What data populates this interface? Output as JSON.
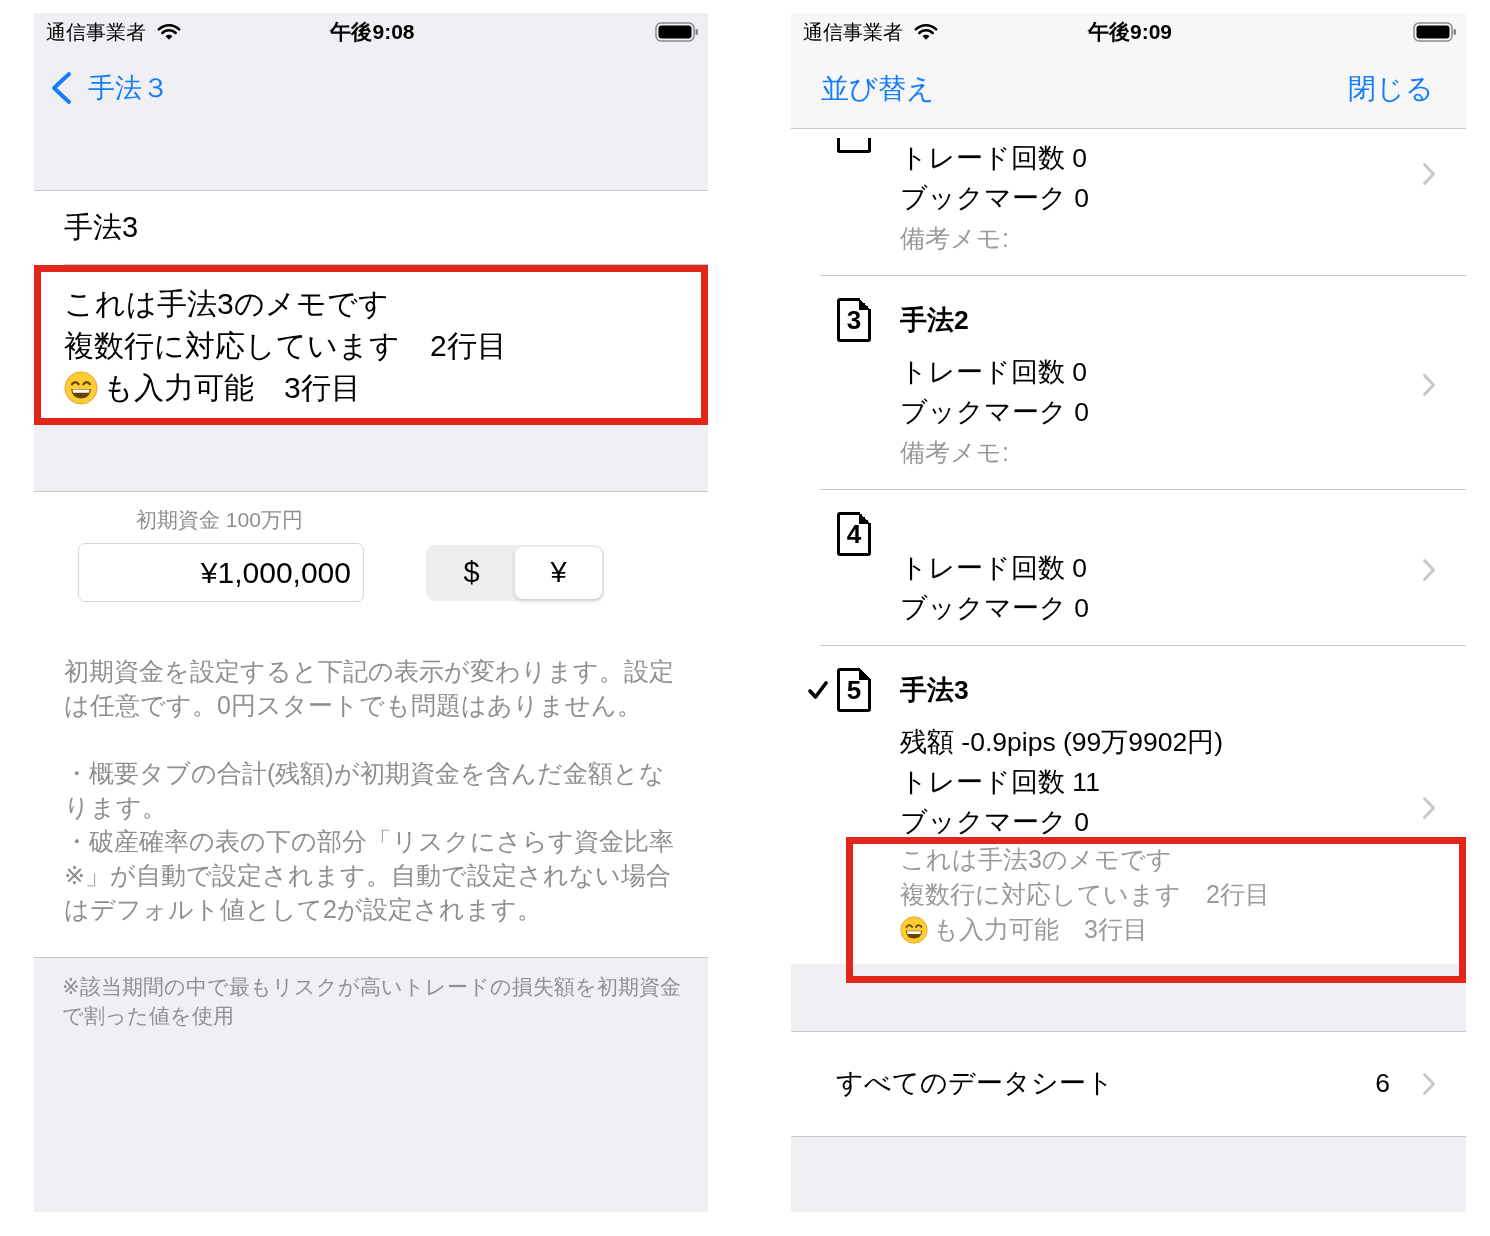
{
  "edit_screen": {
    "status_bar": {
      "carrier": "通信事業者",
      "time": "午後9:08"
    },
    "nav_bar": {
      "back_label": "手法３"
    },
    "name_field": {
      "value": "手法3"
    },
    "memo_field": {
      "highlighted": true,
      "lines": [
        {
          "text": "これは手法3のメモです",
          "leading_emoji": false
        },
        {
          "text": "複数行に対応しています　2行目",
          "leading_emoji": false
        },
        {
          "text": "も入力可能　3行目",
          "leading_emoji": true
        }
      ]
    },
    "initial_capital": {
      "label": "初期資金 100万円",
      "value": "¥1,000,000",
      "currency_segments": [
        {
          "label": "$",
          "selected": false
        },
        {
          "label": "¥",
          "selected": true
        }
      ]
    },
    "help_blocks": [
      [
        "初期資金を設定すると下記の表示が変わります。設定は任意です。0円スタートでも問題はありません。"
      ],
      [
        "・概要タブの合計(残額)が初期資金を含んだ金額となります。",
        "・破産確率の表の下の部分「リスクにさらす資金比率※」が自動で設定されます。自動で設定されない場合はデフォルト値として2が設定されます。"
      ]
    ],
    "footnote": "※該当期間の中で最もリスクが高いトレードの損失額を初期資金で割った値を使用"
  },
  "list_screen": {
    "status_bar": {
      "carrier": "通信事業者",
      "time": "午後9:09"
    },
    "nav_bar": {
      "left_button": "並び替え",
      "right_button": "閉じる"
    },
    "sheets": [
      {
        "clipped_top": true,
        "selected": false,
        "stats": [
          "トレード回数 0",
          "ブックマーク 0"
        ],
        "memo_label": "備考メモ:"
      },
      {
        "clipped_top": false,
        "selected": false,
        "number": "3",
        "title": "手法2",
        "stats": [
          "トレード回数 0",
          "ブックマーク 0"
        ],
        "memo_label": "備考メモ:"
      },
      {
        "clipped_top": false,
        "selected": false,
        "number": "4",
        "stats": [
          "トレード回数 0",
          "ブックマーク 0"
        ]
      },
      {
        "clipped_top": false,
        "selected": true,
        "number": "5",
        "title": "手法3",
        "stats": [
          "残額 -0.9pips (99万9902円)",
          "トレード回数 11",
          "ブックマーク 0"
        ],
        "memo": {
          "highlighted": true,
          "lines": [
            {
              "text": "これは手法3のメモです",
              "leading_emoji": false
            },
            {
              "text": "複数行に対応しています　2行目",
              "leading_emoji": false
            },
            {
              "text": "も入力可能　3行目",
              "leading_emoji": true
            }
          ]
        }
      }
    ],
    "all_sheets_row": {
      "label": "すべてのデータシート",
      "count": "6"
    }
  }
}
